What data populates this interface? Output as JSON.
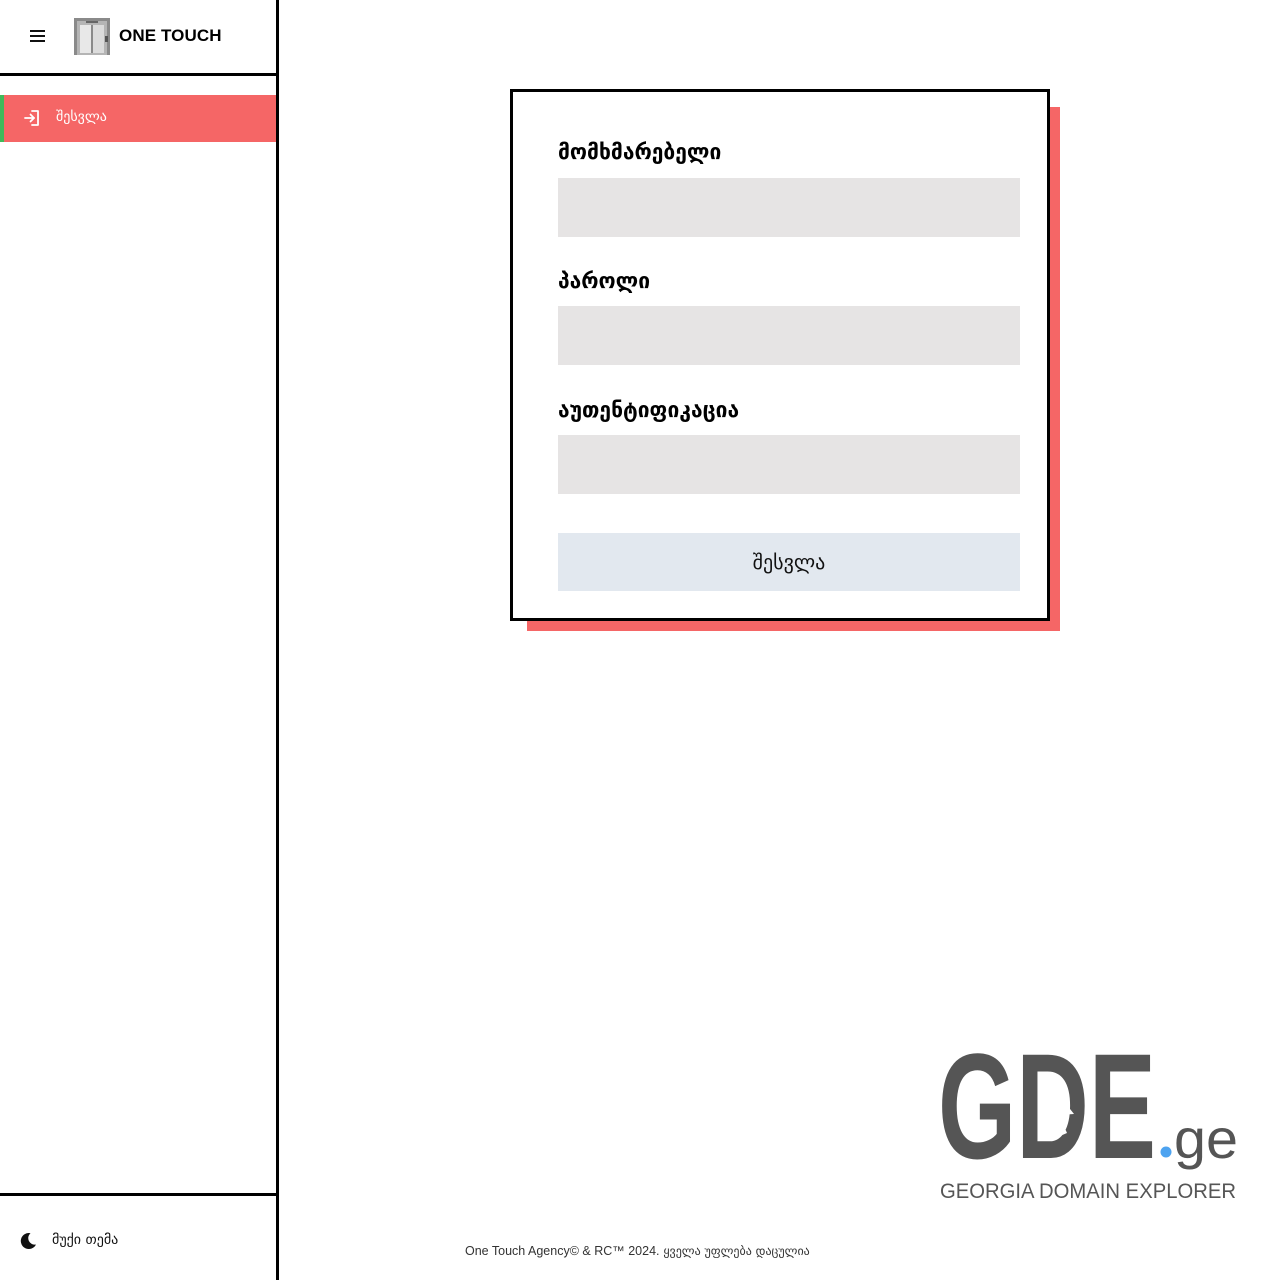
{
  "app": {
    "brand_name": "ONE TOUCH"
  },
  "sidebar": {
    "items": [
      {
        "label": "შესვლა",
        "icon": "login-icon",
        "active": true
      }
    ],
    "theme_toggle": {
      "label": "მუქი თემა",
      "icon": "moon-icon"
    }
  },
  "login_form": {
    "username_label": "მომხმარებელი",
    "username_value": "",
    "password_label": "პაროლი",
    "password_value": "",
    "auth_label": "აუთენტიფიკაცია",
    "auth_value": "",
    "submit_label": "შესვლა"
  },
  "gde_logo": {
    "wordmark": "GDE",
    "suffix": "ge",
    "tagline": "GEORGIA DOMAIN EXPLORER"
  },
  "footer": {
    "copyright_latin": "One Touch Agency© & RC™ 2024.",
    "rights": "ყველა უფლება დაცულია"
  },
  "colors": {
    "accent": "#f56666",
    "active_indicator": "#3fb95a",
    "input_bg": "#e6e4e4",
    "button_bg": "#e2e8ef",
    "logo_gray": "#555555",
    "logo_blue": "#4da3f0"
  }
}
